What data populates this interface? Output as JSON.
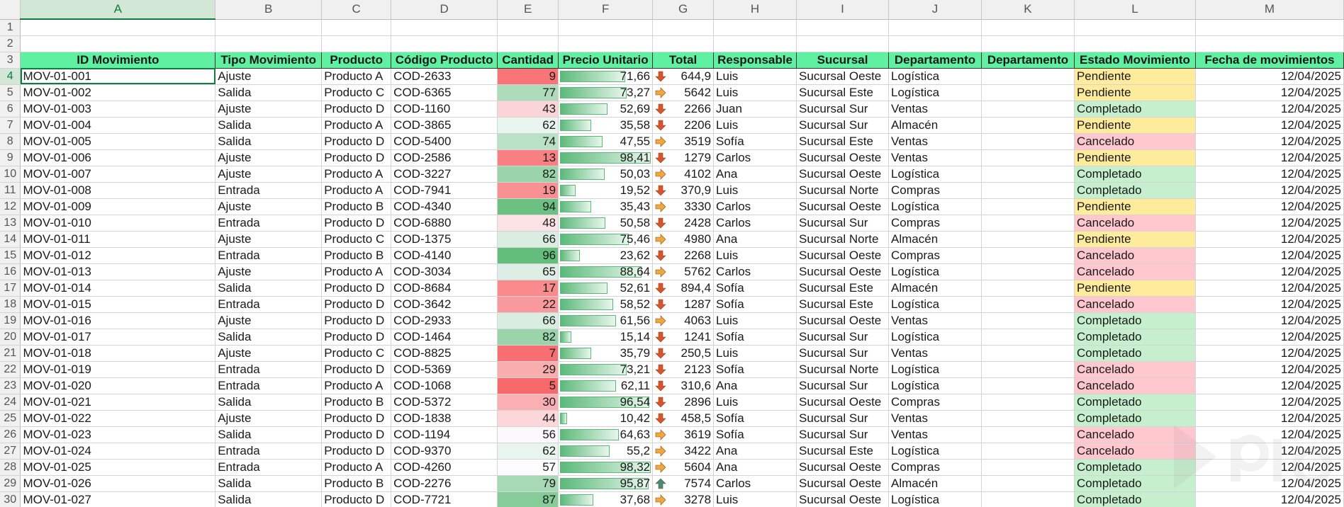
{
  "columns": [
    "A",
    "B",
    "C",
    "D",
    "E",
    "F",
    "G",
    "H",
    "I",
    "J",
    "K",
    "L",
    "M"
  ],
  "header_row": [
    "ID Movimiento",
    "Tipo Movimiento",
    "Producto",
    "Código Producto",
    "Cantidad",
    "Precio Unitario",
    "Total",
    "Responsable",
    "Sucursal",
    "Departamento",
    "Departamento",
    "Estado Movimiento",
    "Fecha de movimientos"
  ],
  "max_price": 98.41,
  "rows": [
    {
      "id": "MOV-01-001",
      "tipo": "Ajuste",
      "producto": "Producto A",
      "codigo": "COD-2633",
      "cantidad": 9,
      "precio": "71,66",
      "precio_num": 71.66,
      "total": "644,9",
      "trend": "down",
      "resp": "Luis",
      "suc": "Sucursal Oeste",
      "dep": "Logística",
      "estado": "Pendiente",
      "fecha": "12/04/2025"
    },
    {
      "id": "MOV-01-002",
      "tipo": "Salida",
      "producto": "Producto C",
      "codigo": "COD-6365",
      "cantidad": 77,
      "precio": "73,27",
      "precio_num": 73.27,
      "total": "5642",
      "trend": "side",
      "resp": "Luis",
      "suc": "Sucursal Este",
      "dep": "Logística",
      "estado": "Pendiente",
      "fecha": "12/04/2025"
    },
    {
      "id": "MOV-01-003",
      "tipo": "Ajuste",
      "producto": "Producto D",
      "codigo": "COD-1160",
      "cantidad": 43,
      "precio": "52,69",
      "precio_num": 52.69,
      "total": "2266",
      "trend": "down",
      "resp": "Juan",
      "suc": "Sucursal Sur",
      "dep": "Ventas",
      "estado": "Completado",
      "fecha": "12/04/2025"
    },
    {
      "id": "MOV-01-004",
      "tipo": "Salida",
      "producto": "Producto A",
      "codigo": "COD-3865",
      "cantidad": 62,
      "precio": "35,58",
      "precio_num": 35.58,
      "total": "2206",
      "trend": "down",
      "resp": "Luis",
      "suc": "Sucursal Sur",
      "dep": "Almacén",
      "estado": "Pendiente",
      "fecha": "12/04/2025"
    },
    {
      "id": "MOV-01-005",
      "tipo": "Salida",
      "producto": "Producto D",
      "codigo": "COD-5400",
      "cantidad": 74,
      "precio": "47,55",
      "precio_num": 47.55,
      "total": "3519",
      "trend": "side",
      "resp": "Sofía",
      "suc": "Sucursal Este",
      "dep": "Ventas",
      "estado": "Cancelado",
      "fecha": "12/04/2025"
    },
    {
      "id": "MOV-01-006",
      "tipo": "Ajuste",
      "producto": "Producto D",
      "codigo": "COD-2586",
      "cantidad": 13,
      "precio": "98,41",
      "precio_num": 98.41,
      "total": "1279",
      "trend": "down",
      "resp": "Carlos",
      "suc": "Sucursal Oeste",
      "dep": "Ventas",
      "estado": "Pendiente",
      "fecha": "12/04/2025"
    },
    {
      "id": "MOV-01-007",
      "tipo": "Ajuste",
      "producto": "Producto A",
      "codigo": "COD-3227",
      "cantidad": 82,
      "precio": "50,03",
      "precio_num": 50.03,
      "total": "4102",
      "trend": "side",
      "resp": "Ana",
      "suc": "Sucursal Oeste",
      "dep": "Logística",
      "estado": "Completado",
      "fecha": "12/04/2025"
    },
    {
      "id": "MOV-01-008",
      "tipo": "Entrada",
      "producto": "Producto A",
      "codigo": "COD-7941",
      "cantidad": 19,
      "precio": "19,52",
      "precio_num": 19.52,
      "total": "370,9",
      "trend": "down",
      "resp": "Luis",
      "suc": "Sucursal Norte",
      "dep": "Compras",
      "estado": "Completado",
      "fecha": "12/04/2025"
    },
    {
      "id": "MOV-01-009",
      "tipo": "Ajuste",
      "producto": "Producto B",
      "codigo": "COD-4340",
      "cantidad": 94,
      "precio": "35,43",
      "precio_num": 35.43,
      "total": "3330",
      "trend": "side",
      "resp": "Carlos",
      "suc": "Sucursal Oeste",
      "dep": "Logística",
      "estado": "Pendiente",
      "fecha": "12/04/2025"
    },
    {
      "id": "MOV-01-010",
      "tipo": "Entrada",
      "producto": "Producto D",
      "codigo": "COD-6880",
      "cantidad": 48,
      "precio": "50,58",
      "precio_num": 50.58,
      "total": "2428",
      "trend": "down",
      "resp": "Carlos",
      "suc": "Sucursal Sur",
      "dep": "Compras",
      "estado": "Cancelado",
      "fecha": "12/04/2025"
    },
    {
      "id": "MOV-01-011",
      "tipo": "Ajuste",
      "producto": "Producto C",
      "codigo": "COD-1375",
      "cantidad": 66,
      "precio": "75,46",
      "precio_num": 75.46,
      "total": "4980",
      "trend": "side",
      "resp": "Ana",
      "suc": "Sucursal Norte",
      "dep": "Almacén",
      "estado": "Pendiente",
      "fecha": "12/04/2025"
    },
    {
      "id": "MOV-01-012",
      "tipo": "Entrada",
      "producto": "Producto B",
      "codigo": "COD-4140",
      "cantidad": 96,
      "precio": "23,62",
      "precio_num": 23.62,
      "total": "2268",
      "trend": "down",
      "resp": "Luis",
      "suc": "Sucursal Oeste",
      "dep": "Compras",
      "estado": "Cancelado",
      "fecha": "12/04/2025"
    },
    {
      "id": "MOV-01-013",
      "tipo": "Ajuste",
      "producto": "Producto A",
      "codigo": "COD-3034",
      "cantidad": 65,
      "precio": "88,64",
      "precio_num": 88.64,
      "total": "5762",
      "trend": "side",
      "resp": "Carlos",
      "suc": "Sucursal Oeste",
      "dep": "Logística",
      "estado": "Cancelado",
      "fecha": "12/04/2025"
    },
    {
      "id": "MOV-01-014",
      "tipo": "Salida",
      "producto": "Producto D",
      "codigo": "COD-8684",
      "cantidad": 17,
      "precio": "52,61",
      "precio_num": 52.61,
      "total": "894,4",
      "trend": "down",
      "resp": "Sofía",
      "suc": "Sucursal Este",
      "dep": "Almacén",
      "estado": "Pendiente",
      "fecha": "12/04/2025"
    },
    {
      "id": "MOV-01-015",
      "tipo": "Entrada",
      "producto": "Producto D",
      "codigo": "COD-3642",
      "cantidad": 22,
      "precio": "58,52",
      "precio_num": 58.52,
      "total": "1287",
      "trend": "down",
      "resp": "Sofía",
      "suc": "Sucursal Este",
      "dep": "Logística",
      "estado": "Cancelado",
      "fecha": "12/04/2025"
    },
    {
      "id": "MOV-01-016",
      "tipo": "Ajuste",
      "producto": "Producto D",
      "codigo": "COD-2933",
      "cantidad": 66,
      "precio": "61,56",
      "precio_num": 61.56,
      "total": "4063",
      "trend": "side",
      "resp": "Luis",
      "suc": "Sucursal Oeste",
      "dep": "Ventas",
      "estado": "Completado",
      "fecha": "12/04/2025"
    },
    {
      "id": "MOV-01-017",
      "tipo": "Salida",
      "producto": "Producto D",
      "codigo": "COD-1464",
      "cantidad": 82,
      "precio": "15,14",
      "precio_num": 15.14,
      "total": "1241",
      "trend": "down",
      "resp": "Sofía",
      "suc": "Sucursal Sur",
      "dep": "Logística",
      "estado": "Completado",
      "fecha": "12/04/2025"
    },
    {
      "id": "MOV-01-018",
      "tipo": "Ajuste",
      "producto": "Producto C",
      "codigo": "COD-8825",
      "cantidad": 7,
      "precio": "35,79",
      "precio_num": 35.79,
      "total": "250,5",
      "trend": "down",
      "resp": "Luis",
      "suc": "Sucursal Sur",
      "dep": "Ventas",
      "estado": "Completado",
      "fecha": "12/04/2025"
    },
    {
      "id": "MOV-01-019",
      "tipo": "Entrada",
      "producto": "Producto D",
      "codigo": "COD-5369",
      "cantidad": 29,
      "precio": "73,21",
      "precio_num": 73.21,
      "total": "2123",
      "trend": "down",
      "resp": "Sofía",
      "suc": "Sucursal Norte",
      "dep": "Logística",
      "estado": "Cancelado",
      "fecha": "12/04/2025"
    },
    {
      "id": "MOV-01-020",
      "tipo": "Entrada",
      "producto": "Producto A",
      "codigo": "COD-1068",
      "cantidad": 5,
      "precio": "62,11",
      "precio_num": 62.11,
      "total": "310,6",
      "trend": "down",
      "resp": "Ana",
      "suc": "Sucursal Sur",
      "dep": "Logística",
      "estado": "Cancelado",
      "fecha": "12/04/2025"
    },
    {
      "id": "MOV-01-021",
      "tipo": "Salida",
      "producto": "Producto B",
      "codigo": "COD-5372",
      "cantidad": 30,
      "precio": "96,54",
      "precio_num": 96.54,
      "total": "2896",
      "trend": "down",
      "resp": "Luis",
      "suc": "Sucursal Oeste",
      "dep": "Compras",
      "estado": "Completado",
      "fecha": "12/04/2025"
    },
    {
      "id": "MOV-01-022",
      "tipo": "Ajuste",
      "producto": "Producto D",
      "codigo": "COD-1838",
      "cantidad": 44,
      "precio": "10,42",
      "precio_num": 10.42,
      "total": "458,5",
      "trend": "down",
      "resp": "Sofía",
      "suc": "Sucursal Sur",
      "dep": "Ventas",
      "estado": "Completado",
      "fecha": "12/04/2025"
    },
    {
      "id": "MOV-01-023",
      "tipo": "Salida",
      "producto": "Producto D",
      "codigo": "COD-1194",
      "cantidad": 56,
      "precio": "64,63",
      "precio_num": 64.63,
      "total": "3619",
      "trend": "side",
      "resp": "Sofía",
      "suc": "Sucursal Sur",
      "dep": "Ventas",
      "estado": "Cancelado",
      "fecha": "12/04/2025"
    },
    {
      "id": "MOV-01-024",
      "tipo": "Entrada",
      "producto": "Producto D",
      "codigo": "COD-9370",
      "cantidad": 62,
      "precio": "55,2",
      "precio_num": 55.2,
      "total": "3422",
      "trend": "side",
      "resp": "Ana",
      "suc": "Sucursal Este",
      "dep": "Logística",
      "estado": "Cancelado",
      "fecha": "12/04/2025"
    },
    {
      "id": "MOV-01-025",
      "tipo": "Entrada",
      "producto": "Producto A",
      "codigo": "COD-4260",
      "cantidad": 57,
      "precio": "98,32",
      "precio_num": 98.32,
      "total": "5604",
      "trend": "side",
      "resp": "Ana",
      "suc": "Sucursal Oeste",
      "dep": "Compras",
      "estado": "Completado",
      "fecha": "12/04/2025"
    },
    {
      "id": "MOV-01-026",
      "tipo": "Salida",
      "producto": "Producto B",
      "codigo": "COD-2276",
      "cantidad": 79,
      "precio": "95,87",
      "precio_num": 95.87,
      "total": "7574",
      "trend": "up",
      "resp": "Carlos",
      "suc": "Sucursal Oeste",
      "dep": "Almacén",
      "estado": "Completado",
      "fecha": "12/04/2025"
    },
    {
      "id": "MOV-01-027",
      "tipo": "Salida",
      "producto": "Producto D",
      "codigo": "COD-7721",
      "cantidad": 87,
      "precio": "37,68",
      "precio_num": 37.68,
      "total": "3278",
      "trend": "side",
      "resp": "Luis",
      "suc": "Sucursal Oeste",
      "dep": "Logística",
      "estado": "Completado",
      "fecha": "12/04/2025"
    }
  ],
  "colors": {
    "header_fill": "#5ff1a1",
    "select_accent": "#107c41",
    "status_pending_bg": "#ffeb9c",
    "status_done_bg": "#c6efce",
    "status_cancel_bg": "#ffc7ce",
    "scale_low": "#f8696b",
    "scale_high": "#63be7b",
    "arrow_down": "#d9532c",
    "arrow_side": "#f0a83c",
    "arrow_up": "#3f8f7b"
  }
}
